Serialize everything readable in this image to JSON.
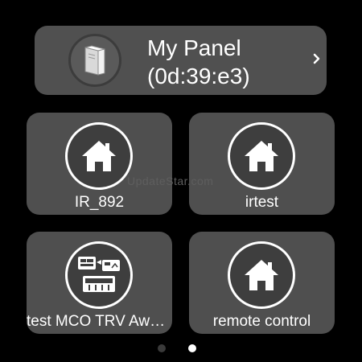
{
  "panel": {
    "title": "My Panel",
    "subtitle": "(0d:39:e3)",
    "icon": "panel-box-icon",
    "chevron": "chevron-right-icon"
  },
  "tiles": [
    {
      "label": "IR_892",
      "icon": "home-icon"
    },
    {
      "label": "irtest",
      "icon": "home-icon"
    },
    {
      "label": "test MCO TRV Aw…",
      "icon": "scene-devices-icon"
    },
    {
      "label": "remote control",
      "icon": "home-icon"
    }
  ],
  "watermark": "UpdateStar.com",
  "pager": {
    "pages": 2,
    "current_page": 2
  },
  "colors": {
    "background": "#000000",
    "card": "#505050",
    "tile": "#4f4f4f",
    "icon_circle": "#3e3e3e",
    "text": "#ffffff",
    "dot_inactive": "#3a3a3a",
    "dot_active": "#ffffff"
  }
}
